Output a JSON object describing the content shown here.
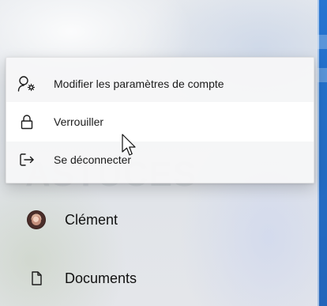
{
  "menu": {
    "items": [
      {
        "label": "Modifier les paramètres de compte",
        "icon": "user-settings-icon"
      },
      {
        "label": "Verrouiller",
        "icon": "lock-icon"
      },
      {
        "label": "Se déconnecter",
        "icon": "sign-out-icon"
      }
    ],
    "hovered_index": 1
  },
  "sidebar": {
    "items": [
      {
        "label": "Clément",
        "icon": "avatar"
      },
      {
        "label": "Documents",
        "icon": "document-icon"
      }
    ]
  },
  "watermark": {
    "text": "ASTUCES"
  },
  "colors": {
    "accent_strip": "#1c6fd0"
  }
}
